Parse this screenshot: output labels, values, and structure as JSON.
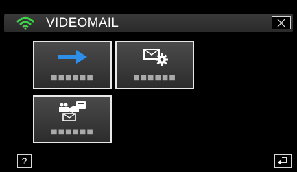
{
  "header": {
    "title": "VIDEOMAIL",
    "wifi_icon": "wifi-icon",
    "close_icon": "close-icon"
  },
  "tiles": [
    {
      "icon": "arrow-right-icon",
      "label": "■■■■■■"
    },
    {
      "icon": "mail-settings-icon",
      "label": "■■■■■■"
    },
    {
      "icon": "camera-mail-printer-icon",
      "label": "■■■■■■"
    }
  ],
  "footer": {
    "help_label": "?",
    "back_icon": "back-return-icon"
  },
  "colors": {
    "wifi": "#3fd24a",
    "arrow": "#2f8fe6",
    "tile_border": "#e8e8e8",
    "background": "#000000"
  }
}
